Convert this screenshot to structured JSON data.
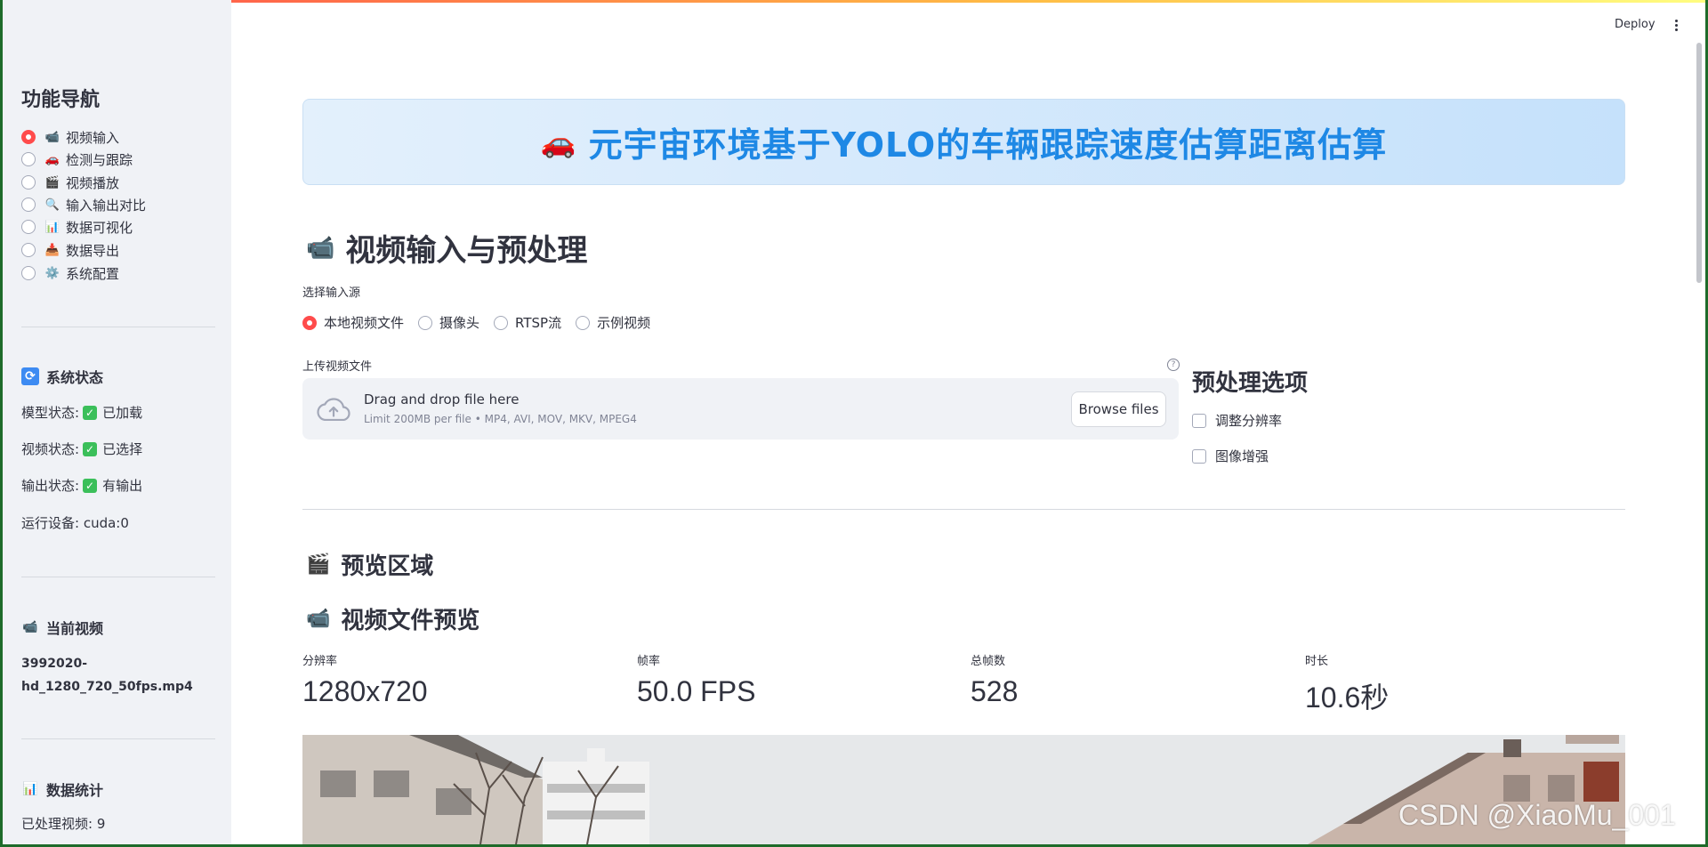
{
  "header": {
    "deploy_label": "Deploy"
  },
  "sidebar": {
    "title": "功能导航",
    "nav": [
      {
        "icon": "📹",
        "label": "视频输入",
        "selected": true
      },
      {
        "icon": "🚗",
        "label": "检测与跟踪",
        "selected": false
      },
      {
        "icon": "🎬",
        "label": "视频播放",
        "selected": false
      },
      {
        "icon": "🔍",
        "label": "输入输出对比",
        "selected": false
      },
      {
        "icon": "📊",
        "label": "数据可视化",
        "selected": false
      },
      {
        "icon": "📥",
        "label": "数据导出",
        "selected": false
      },
      {
        "icon": "⚙️",
        "label": "系统配置",
        "selected": false
      }
    ],
    "status": {
      "title": "系统状态",
      "model_label": "模型状态:",
      "model_value": "已加载",
      "video_label": "视频状态:",
      "video_value": "已选择",
      "output_label": "输出状态:",
      "output_value": "有输出",
      "device": "运行设备: cuda:0"
    },
    "current_video": {
      "title": "当前视频",
      "filename": "3992020-hd_1280_720_50fps.mp4"
    },
    "stats": {
      "title": "数据统计",
      "processed": "已处理视频: 9"
    }
  },
  "main": {
    "banner": "元宇宙环境基于YOLO的车辆跟踪速度估算距离估算",
    "section_title": "视频输入与预处理",
    "source_label": "选择输入源",
    "sources": [
      {
        "label": "本地视频文件",
        "selected": true
      },
      {
        "label": "摄像头",
        "selected": false
      },
      {
        "label": "RTSP流",
        "selected": false
      },
      {
        "label": "示例视频",
        "selected": false
      }
    ],
    "upload": {
      "label": "上传视频文件",
      "drag_text": "Drag and drop file here",
      "limit_text": "Limit 200MB per file • MP4, AVI, MOV, MKV, MPEG4",
      "browse_label": "Browse files",
      "help_mark": "?"
    },
    "preprocess": {
      "title": "预处理选项",
      "options": [
        "调整分辨率",
        "图像增强"
      ]
    },
    "preview_title": "预览区域",
    "file_preview_title": "视频文件预览",
    "metrics": [
      {
        "label": "分辨率",
        "value": "1280x720"
      },
      {
        "label": "帧率",
        "value": "50.0 FPS"
      },
      {
        "label": "总帧数",
        "value": "528"
      },
      {
        "label": "时长",
        "value": "10.6秒"
      }
    ]
  },
  "watermark": "CSDN @XiaoMu_001",
  "colors": {
    "accent": "#ff4b4b",
    "banner_text": "#1e88e5",
    "check_green": "#3bbf5a"
  }
}
